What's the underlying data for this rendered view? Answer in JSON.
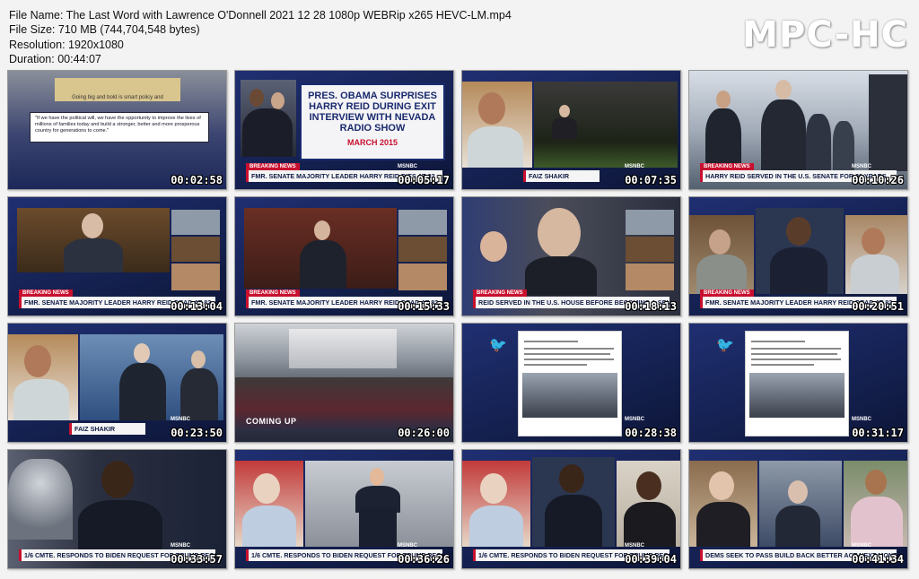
{
  "file_info": {
    "name_line": "File Name: The Last Word with Lawrence O'Donnell 2021 12 28 1080p WEBRip x265 HEVC-LM.mp4",
    "size_line": "File Size: 710 MB (744,704,548 bytes)",
    "resolution_line": "Resolution: 1920x1080",
    "duration_line": "Duration: 00:44:07"
  },
  "logo": "MPC-HC",
  "thumbnails": [
    {
      "timestamp": "00:02:58",
      "chyron": "",
      "breaking": "",
      "quote": "\"If we have the political will, we have the opportunity to improve the lives of millions of families today and build a stronger, better and more prosperous country for generations to come.\"",
      "sign": "Going big and bold is smart policy and"
    },
    {
      "timestamp": "00:05:17",
      "chyron": "FMR. SENATE MAJORITY LEADER HARRY REID DIES AT 82",
      "breaking": "BREAKING NEWS",
      "headline": "PRES. OBAMA SURPRISES HARRY REID DURING EXIT INTERVIEW WITH NEVADA RADIO SHOW",
      "headline_date": "MARCH 2015"
    },
    {
      "timestamp": "00:07:35",
      "chyron": "FAIZ SHAKIR",
      "breaking": ""
    },
    {
      "timestamp": "00:10:26",
      "chyron": "HARRY REID SERVED IN THE U.S. SENATE FOR 30 YEARS",
      "breaking": "BREAKING NEWS"
    },
    {
      "timestamp": "00:13:04",
      "chyron": "FMR. SENATE MAJORITY LEADER HARRY REID DEAD AT 82",
      "breaking": "BREAKING NEWS"
    },
    {
      "timestamp": "00:15:33",
      "chyron": "FMR. SENATE MAJORITY LEADER HARRY REID DEAD AT 82",
      "breaking": "BREAKING NEWS"
    },
    {
      "timestamp": "00:18:13",
      "chyron": "REID SERVED IN THE U.S. HOUSE BEFORE BECOMING A SENATOR",
      "breaking": "BREAKING NEWS"
    },
    {
      "timestamp": "00:20:51",
      "chyron": "FMR. SENATE MAJORITY LEADER HARRY REID DEAD AT 82",
      "breaking": "BREAKING NEWS"
    },
    {
      "timestamp": "00:23:50",
      "chyron": "FAIZ SHAKIR",
      "breaking": ""
    },
    {
      "timestamp": "00:26:00",
      "chyron": "",
      "breaking": "",
      "coming": "COMING UP"
    },
    {
      "timestamp": "00:28:38",
      "chyron": "",
      "breaking": ""
    },
    {
      "timestamp": "00:31:17",
      "chyron": "",
      "breaking": ""
    },
    {
      "timestamp": "00:33:57",
      "chyron": "1/6 CMTE. RESPONDS TO BIDEN REQUEST FOR TRUMP RECORDS",
      "breaking": ""
    },
    {
      "timestamp": "00:36:26",
      "chyron": "1/6 CMTE. RESPONDS TO BIDEN REQUEST FOR TRUMP RECORDS",
      "breaking": ""
    },
    {
      "timestamp": "00:39:04",
      "chyron": "1/6 CMTE. RESPONDS TO BIDEN REQUEST FOR TRUMP RECORDS",
      "breaking": ""
    },
    {
      "timestamp": "00:41:34",
      "chyron": "DEMS SEEK TO PASS BUILD BACK BETTER ACT NEXT MONTH",
      "breaking": ""
    }
  ],
  "network_bug": "MSNBC",
  "colors": {
    "navy": "#1a2a6e",
    "breaking_red": "#c8102e",
    "sheet_bg": "#f3f3f3"
  }
}
